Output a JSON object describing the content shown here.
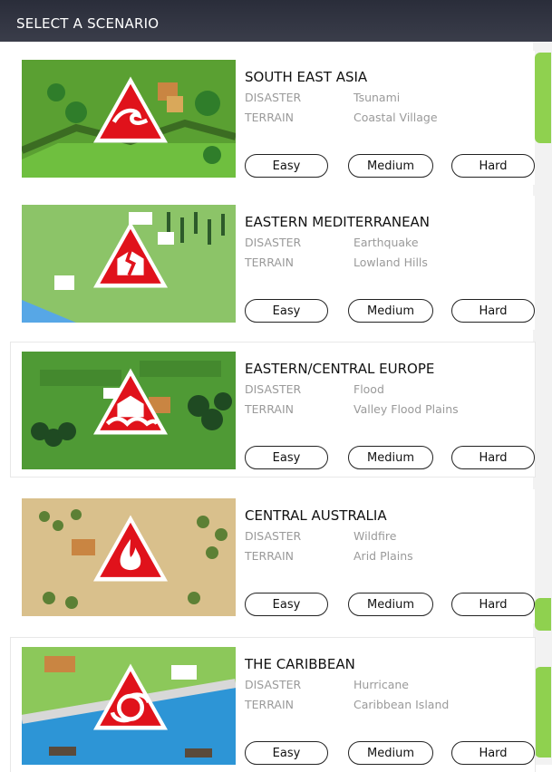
{
  "header": {
    "title": "SELECT A SCENARIO"
  },
  "scenarios": [
    {
      "title": "SOUTH EAST ASIA",
      "disaster_label": "DISASTER",
      "disaster": "Tsunami",
      "terrain_label": "TERRAIN",
      "terrain": "Coastal Village",
      "icon": "tsunami-icon",
      "buttons": {
        "easy": "Easy",
        "medium": "Medium",
        "hard": "Hard"
      },
      "palette": {
        "ground": "#5aa032",
        "accent": "#2f7d2a"
      }
    },
    {
      "title": "EASTERN MEDITERRANEAN",
      "disaster_label": "DISASTER",
      "disaster": "Earthquake",
      "terrain_label": "TERRAIN",
      "terrain": "Lowland Hills",
      "icon": "earthquake-icon",
      "buttons": {
        "easy": "Easy",
        "medium": "Medium",
        "hard": "Hard"
      },
      "palette": {
        "ground": "#8cc468",
        "accent": "#2d5a2a"
      }
    },
    {
      "title": "EASTERN/CENTRAL EUROPE",
      "disaster_label": "DISASTER",
      "disaster": "Flood",
      "terrain_label": "TERRAIN",
      "terrain": "Valley Flood Plains",
      "icon": "flood-icon",
      "buttons": {
        "easy": "Easy",
        "medium": "Medium",
        "hard": "Hard"
      },
      "palette": {
        "ground": "#4f9a35",
        "accent": "#1f4a22"
      }
    },
    {
      "title": "CENTRAL AUSTRALIA",
      "disaster_label": "DISASTER",
      "disaster": "Wildfire",
      "terrain_label": "TERRAIN",
      "terrain": "Arid Plains",
      "icon": "wildfire-icon",
      "buttons": {
        "easy": "Easy",
        "medium": "Medium",
        "hard": "Hard"
      },
      "palette": {
        "ground": "#d9c08c",
        "accent": "#4f7a2c"
      }
    },
    {
      "title": "THE CARIBBEAN",
      "disaster_label": "DISASTER",
      "disaster": "Hurricane",
      "terrain_label": "TERRAIN",
      "terrain": "Caribbean Island",
      "icon": "hurricane-icon",
      "buttons": {
        "easy": "Easy",
        "medium": "Medium",
        "hard": "Hard"
      },
      "palette": {
        "ground": "#8cc85a",
        "accent": "#2d95d6"
      }
    }
  ],
  "colors": {
    "header_bg": "#2f3240",
    "hazard_red": "#e0121b",
    "scroll_green": "#8fd14f",
    "button_border": "#222222"
  }
}
